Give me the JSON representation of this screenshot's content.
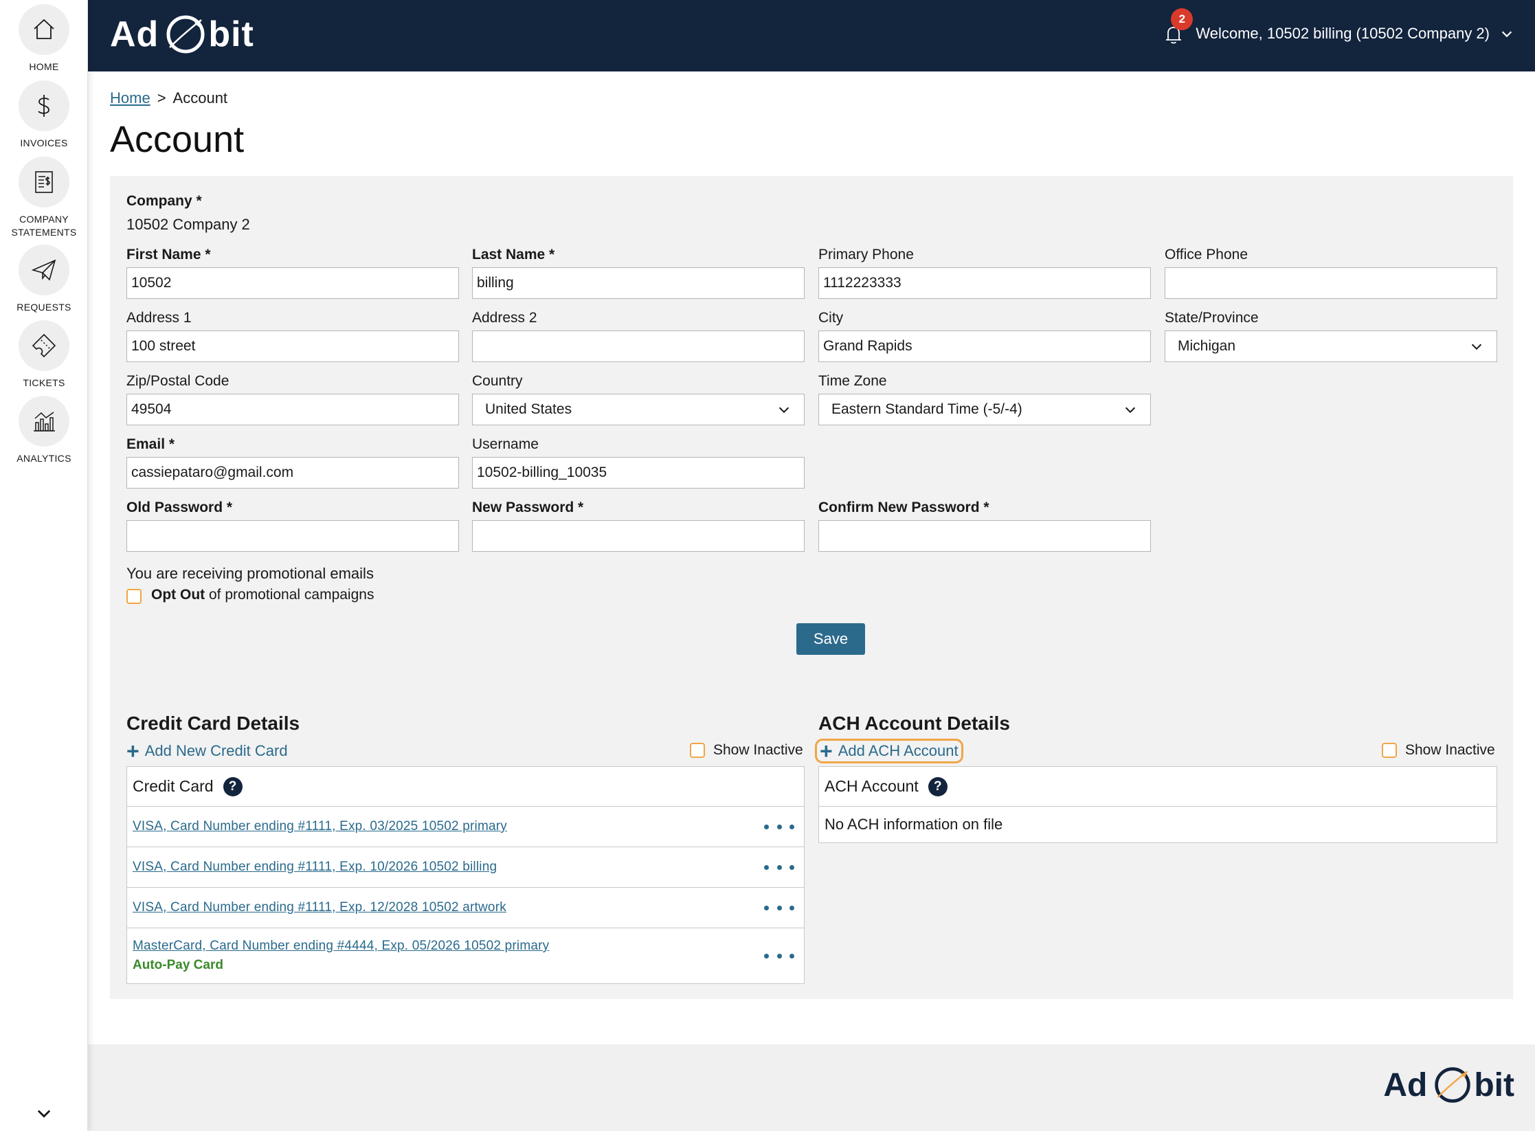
{
  "app": {
    "logo_left": "Ad",
    "logo_right": "bit"
  },
  "sidebar": {
    "items": [
      {
        "label": "HOME",
        "icon": "home-icon"
      },
      {
        "label": "INVOICES",
        "icon": "dollar-icon"
      },
      {
        "label": "COMPANY\nSTATEMENTS",
        "icon": "statement-icon"
      },
      {
        "label": "REQUESTS",
        "icon": "paper-plane-icon"
      },
      {
        "label": "TICKETS",
        "icon": "ticket-icon"
      },
      {
        "label": "ANALYTICS",
        "icon": "analytics-icon"
      }
    ]
  },
  "header": {
    "notification_count": "2",
    "welcome_text": "Welcome, 10502 billing (10502 Company 2)"
  },
  "breadcrumb": {
    "home": "Home",
    "separator": ">",
    "current": "Account"
  },
  "page": {
    "title": "Account"
  },
  "form": {
    "company_label": "Company *",
    "company_value": "10502 Company 2",
    "first_name_label": "First Name *",
    "first_name_value": "10502",
    "last_name_label": "Last Name *",
    "last_name_value": "billing",
    "primary_phone_label": "Primary Phone",
    "primary_phone_value": "1112223333",
    "office_phone_label": "Office Phone",
    "office_phone_value": "",
    "address1_label": "Address 1",
    "address1_value": "100 street",
    "address2_label": "Address 2",
    "address2_value": "",
    "city_label": "City",
    "city_value": "Grand Rapids",
    "state_label": "State/Province",
    "state_value": "Michigan",
    "zip_label": "Zip/Postal Code",
    "zip_value": "49504",
    "country_label": "Country",
    "country_value": "United States",
    "timezone_label": "Time Zone",
    "timezone_value": "Eastern Standard Time (-5/-4)",
    "email_label": "Email *",
    "email_value": "cassiepataro@gmail.com",
    "username_label": "Username",
    "username_value": "10502-billing_10035",
    "old_password_label": "Old Password *",
    "new_password_label": "New Password *",
    "confirm_password_label": "Confirm New Password *",
    "promo_text": "You are receiving promotional emails",
    "optout_bold": "Opt Out",
    "optout_rest": " of promotional campaigns",
    "save_label": "Save"
  },
  "credit_cards": {
    "title": "Credit Card Details",
    "add_label": "Add New Credit Card",
    "show_inactive": "Show Inactive",
    "column_header": "Credit Card",
    "rows": [
      {
        "text": "VISA, Card Number ending #1111, Exp. 03/2025 10502 primary"
      },
      {
        "text": "VISA, Card Number ending #1111, Exp. 10/2026 10502 billing"
      },
      {
        "text": "VISA, Card Number ending #1111, Exp. 12/2028 10502 artwork"
      },
      {
        "text": "MasterCard, Card Number ending #4444, Exp. 05/2026 10502 primary",
        "badge": "Auto-Pay Card"
      }
    ]
  },
  "ach": {
    "title": "ACH Account Details",
    "add_label": "Add ACH Account",
    "show_inactive": "Show Inactive",
    "column_header": "ACH Account",
    "empty_text": "No ACH information on file"
  },
  "colors": {
    "navy": "#13243d",
    "accent_blue": "#2c6a8c",
    "focus_orange": "#f0a646",
    "badge_red": "#d93a2b",
    "autopay_green": "#3a8a2a"
  }
}
